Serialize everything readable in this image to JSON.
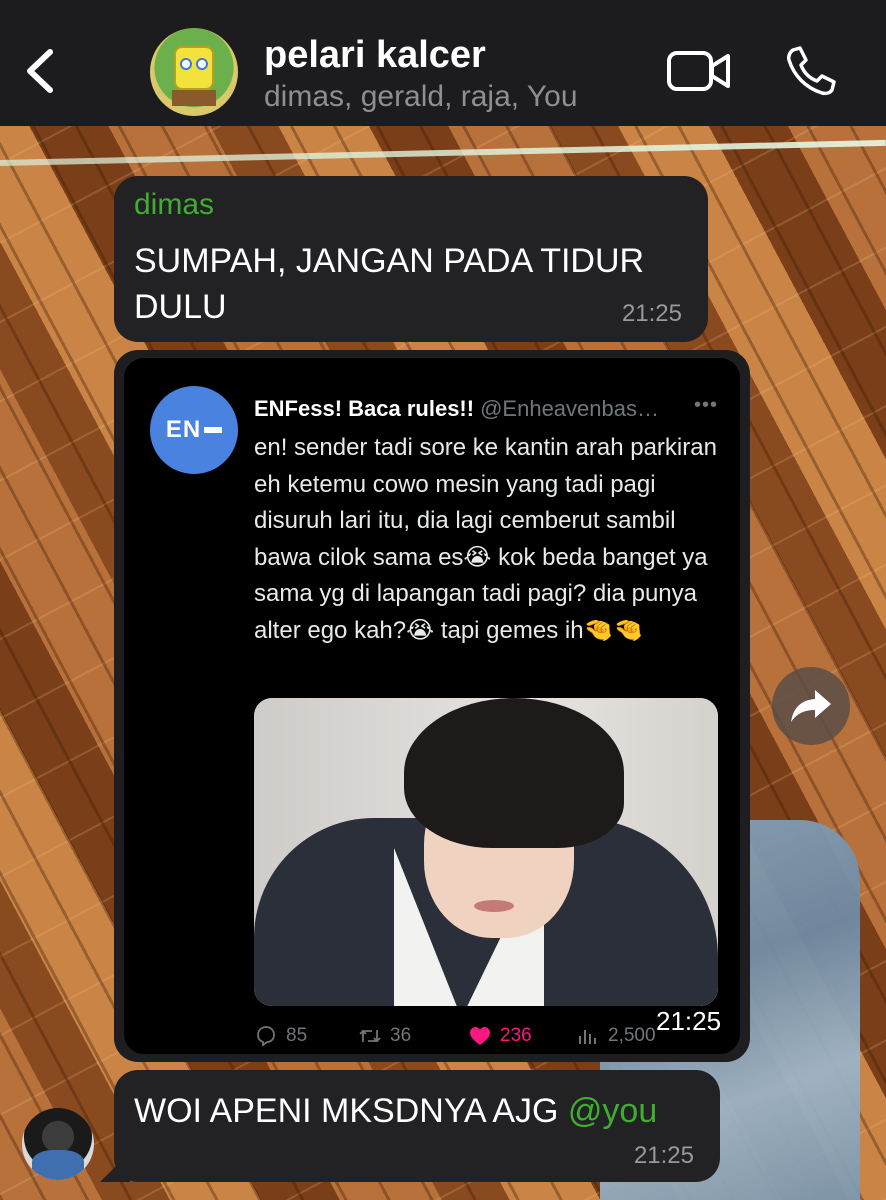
{
  "header": {
    "title": "pelari kalcer",
    "members": "dimas, gerald, raja, You"
  },
  "messages": [
    {
      "sender": "dimas",
      "text": "SUMPAH, JANGAN PADA TIDUR DULU",
      "time": "21:25"
    },
    {
      "tweet": {
        "avatar_text": "EN",
        "name": "ENFess! Baca rules!!",
        "handle": "@Enheavenbas…",
        "more": "•••",
        "body": "en! sender tadi sore ke kantin arah parkiran eh ketemu cowo mesin yang tadi pagi disuruh lari itu, dia lagi cemberut sambil bawa cilok sama es😭 kok beda banget ya sama yg di lapangan tadi pagi? dia punya alter ego kah?😭 tapi gemes ih🤏🤏",
        "replies": "85",
        "retweets": "36",
        "likes": "236",
        "views": "2,500"
      },
      "time": "21:25"
    },
    {
      "text": "WOI APENI MKSDNYA AJG ",
      "mention": "@you",
      "time": "21:25"
    }
  ],
  "colors": {
    "header_bg": "#1c1c1e",
    "bubble_bg": "#222224",
    "sender_green": "#3fae2e",
    "like_pink": "#f91880",
    "tweet_avatar_blue": "#4a82e0"
  },
  "icons": [
    "back-chevron-icon",
    "video-call-icon",
    "phone-icon",
    "more-icon",
    "reply-icon",
    "retweet-icon",
    "like-heart-icon",
    "views-icon",
    "forward-icon"
  ]
}
